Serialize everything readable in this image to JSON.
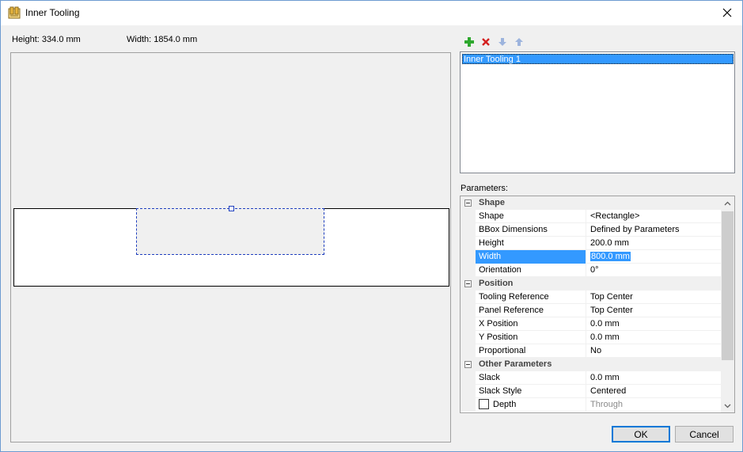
{
  "window": {
    "title": "Inner Tooling",
    "close_glyph": "✕"
  },
  "dimensions": {
    "height": "Height: 334.0 mm",
    "width": "Width: 1854.0 mm"
  },
  "toolbar": {
    "add_icon": "plus-icon",
    "delete_icon": "delete-icon",
    "down_icon": "arrow-down-icon",
    "up_icon": "arrow-up-icon"
  },
  "list": {
    "items": [
      "Inner Tooling 1"
    ]
  },
  "parameters": {
    "label": "Parameters:",
    "categories": {
      "shape": "Shape",
      "position": "Position",
      "other": "Other Parameters"
    },
    "rows": {
      "shape": {
        "name": "Shape",
        "value": "<Rectangle>"
      },
      "bbox": {
        "name": "BBox Dimensions",
        "value": "Defined by Parameters"
      },
      "height": {
        "name": "Height",
        "value": "200.0 mm"
      },
      "width": {
        "name": "Width",
        "value": "800.0 mm"
      },
      "orientation": {
        "name": "Orientation",
        "value": "0°"
      },
      "tooling_reference": {
        "name": "Tooling Reference",
        "value": "Top Center"
      },
      "panel_reference": {
        "name": "Panel Reference",
        "value": "Top Center"
      },
      "x_position": {
        "name": "X Position",
        "value": "0.0 mm"
      },
      "y_position": {
        "name": "Y Position",
        "value": "0.0 mm"
      },
      "proportional": {
        "name": "Proportional",
        "value": "No"
      },
      "slack": {
        "name": "Slack",
        "value": "0.0 mm"
      },
      "slack_style": {
        "name": "Slack Style",
        "value": "Centered"
      },
      "depth": {
        "name": "Depth",
        "value": "Through",
        "checked": false
      }
    }
  },
  "buttons": {
    "ok": "OK",
    "cancel": "Cancel"
  },
  "colors": {
    "selection": "#3399ff",
    "tool_outline": "#1f3fbf",
    "add_green": "#2ea82e",
    "delete_red": "#d42020"
  }
}
